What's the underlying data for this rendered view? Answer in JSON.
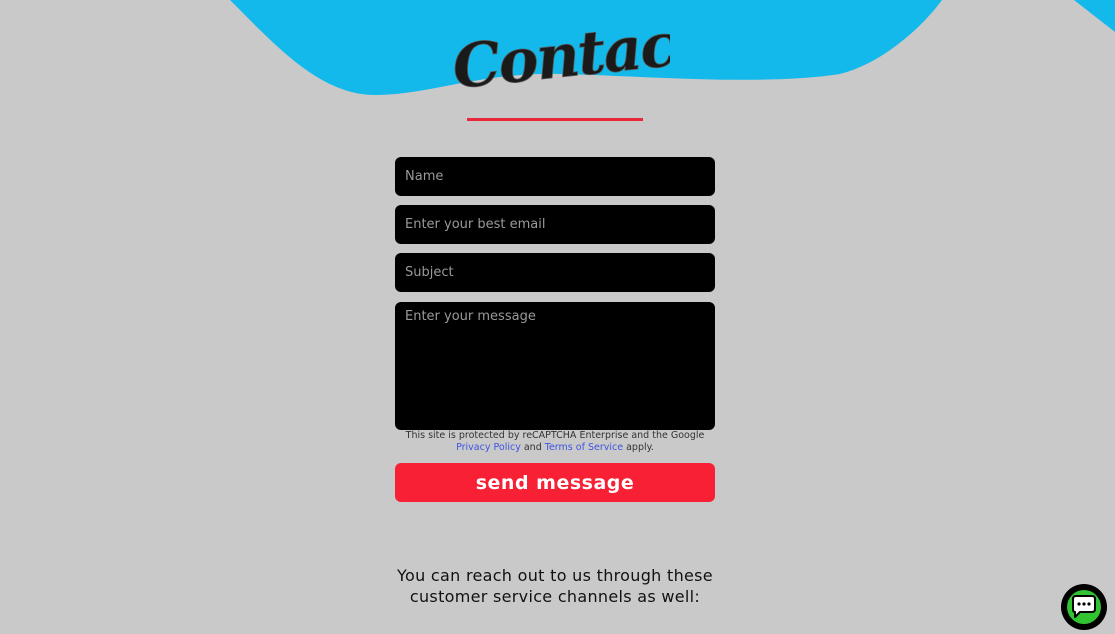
{
  "page": {
    "heading": "Contact:"
  },
  "colors": {
    "background": "#c9c9c9",
    "wave": "#13b9ea",
    "accent": "#f82035",
    "field_background": "#000000",
    "link": "#3d55e0",
    "chat_green": "#31c331"
  },
  "form": {
    "name_placeholder": "Name",
    "email_placeholder": "Enter your best email",
    "subject_placeholder": "Subject",
    "message_placeholder": "Enter your message",
    "recaptcha": {
      "line1": "This site is protected by reCAPTCHA Enterprise and the Google",
      "privacy_link": "Privacy Policy",
      "and_text": "and",
      "terms_link": "Terms of Service",
      "apply_text": "apply."
    },
    "send_label": "send message"
  },
  "footer": {
    "reach_line1": "You can reach out to us through these",
    "reach_line2": "customer service channels as well:"
  },
  "chat": {
    "icon": "chat-bubble-icon"
  }
}
